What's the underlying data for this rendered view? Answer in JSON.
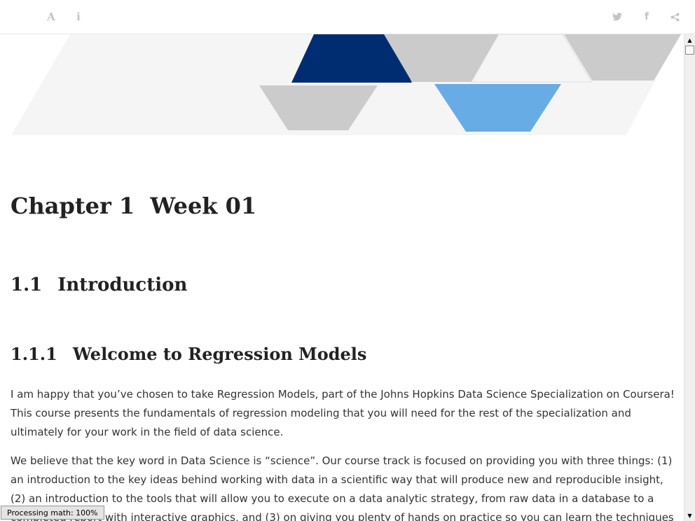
{
  "toolbar": {
    "left_buttons": [
      {
        "icon": "font-settings-icon",
        "glyph": "A"
      },
      {
        "icon": "info-icon",
        "glyph": "i"
      }
    ],
    "right_buttons": [
      {
        "icon": "twitter-icon"
      },
      {
        "icon": "facebook-icon",
        "glyph": "f"
      },
      {
        "icon": "share-icon"
      }
    ],
    "icon_color": "#c4c4c4"
  },
  "banner": {
    "colors": {
      "dark_blue": "#002d72",
      "light_blue": "#68ace5",
      "gray": "#cbcbcb",
      "light_gray": "#f5f5f5"
    }
  },
  "chapter": {
    "number": "Chapter 1",
    "title": "Week 01"
  },
  "section": {
    "number": "1.1",
    "title": "Introduction"
  },
  "subsection": {
    "number": "1.1.1",
    "title": "Welcome to Regression Models"
  },
  "paragraphs": [
    "I am happy that you’ve chosen to take Regression Models, part of the Johns Hopkins Data Science Specialization on Coursera! This course presents the fundamentals of regression modeling that you will need for the rest of the specialization and ultimately for your work in the field of data science.",
    "We believe that the key word in Data Science is “science”. Our course track is focused on providing you with three things: (1) an introduction to the key ideas behind working with data in a scientific way that will produce new and reproducible insight, (2) an introduction to the tools that will allow you to execute on a data analytic strategy, from raw data in a database to a completed report with interactive graphics, and (3) on giving you plenty of hands on practice so you can learn the techniques for yourself."
  ],
  "status": {
    "text": "Processing math: 100%"
  },
  "scrollbar": {
    "up_arrow": "▲",
    "down_arrow": "▼"
  }
}
